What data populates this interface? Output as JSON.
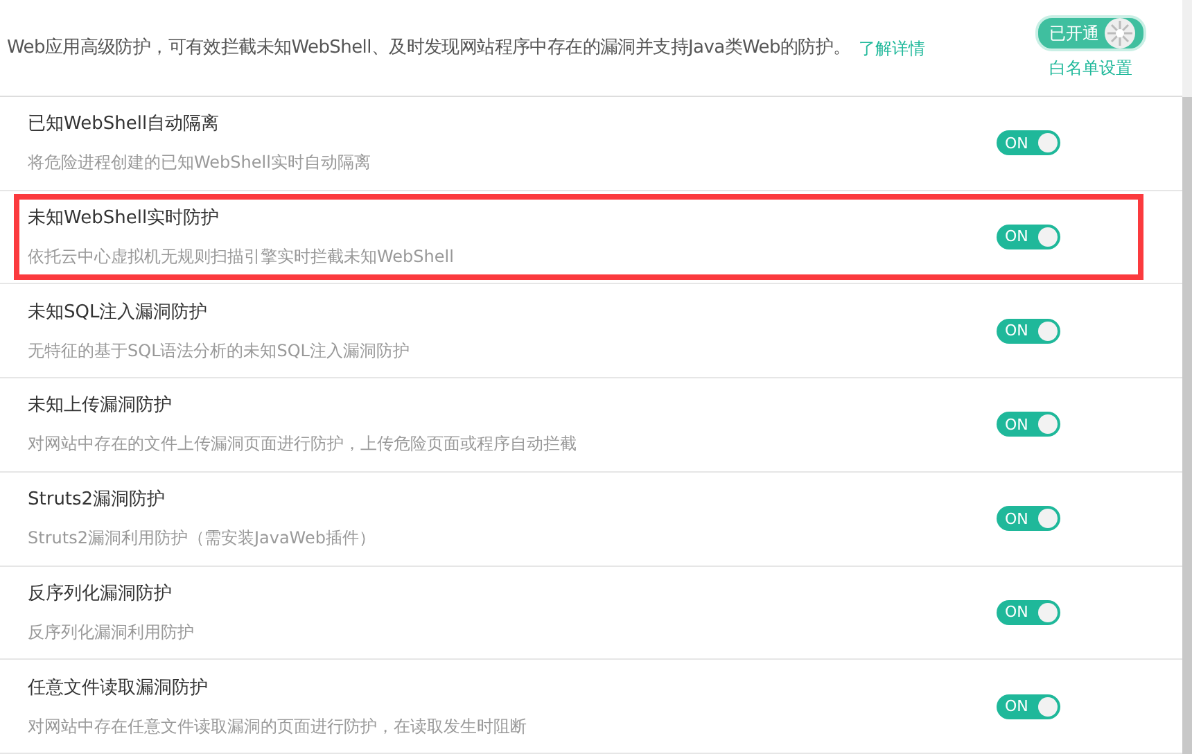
{
  "header": {
    "description": "Web应用高级防护，可有效拦截未知WebShell、及时发现网站程序中存在的漏洞并支持Java类Web的防护。",
    "link": "了解详情",
    "status_toggle": {
      "label": "已开通",
      "on": true
    },
    "whitelist_link": "白名单设置"
  },
  "items": [
    {
      "title": "已知WebShell自动隔离",
      "description": "将危险进程创建的已知WebShell实时自动隔离",
      "toggle": "ON",
      "on": true,
      "highlighted": false
    },
    {
      "title": "未知WebShell实时防护",
      "description": "依托云中心虚拟机无规则扫描引擎实时拦截未知WebShell",
      "toggle": "ON",
      "on": true,
      "highlighted": true
    },
    {
      "title": "未知SQL注入漏洞防护",
      "description": "无特征的基于SQL语法分析的未知SQL注入漏洞防护",
      "toggle": "ON",
      "on": true,
      "highlighted": false
    },
    {
      "title": "未知上传漏洞防护",
      "description": "对网站中存在的文件上传漏洞页面进行防护，上传危险页面或程序自动拦截",
      "toggle": "ON",
      "on": true,
      "highlighted": false
    },
    {
      "title": "Struts2漏洞防护",
      "description": "Struts2漏洞利用防护（需安装JavaWeb插件）",
      "toggle": "ON",
      "on": true,
      "highlighted": false
    },
    {
      "title": "反序列化漏洞防护",
      "description": "反序列化漏洞利用防护",
      "toggle": "ON",
      "on": true,
      "highlighted": false
    },
    {
      "title": "任意文件读取漏洞防护",
      "description": "对网站中存在任意文件读取漏洞的页面进行防护，在读取发生时阻断",
      "toggle": "ON",
      "on": true,
      "highlighted": false
    }
  ]
}
